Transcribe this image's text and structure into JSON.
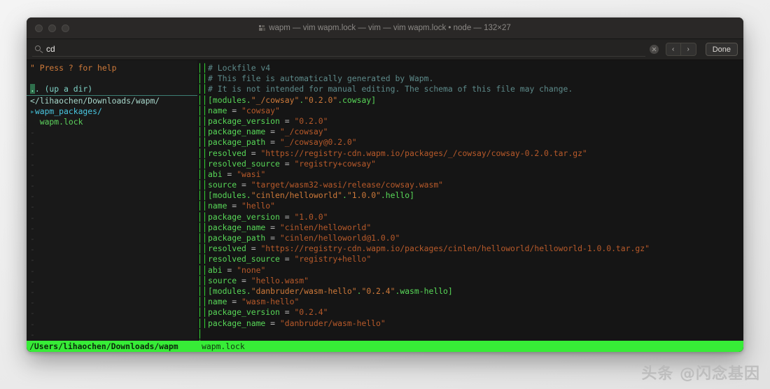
{
  "window": {
    "title": "wapm — vim wapm.lock — vim — vim wapm.lock • node — 132×27",
    "traffic_lights": [
      "close",
      "minimize",
      "zoom"
    ]
  },
  "findbar": {
    "query": "cd",
    "placeholder": "Search",
    "clear_label": "",
    "prev_label": "‹",
    "next_label": "›",
    "done_label": "Done"
  },
  "sidebar": {
    "help_line": "\" Press ? for help",
    "up_dir": ".. (up a dir)",
    "root_path": "/lihaochen/Downloads/wapm/",
    "root_prefix": "<",
    "items": [
      {
        "mark": "▸",
        "label": "wapm_packages/",
        "type": "dir"
      },
      {
        "mark": "",
        "label": "wapm.lock",
        "type": "file"
      }
    ],
    "empty_marker": "-"
  },
  "split": {
    "glyph": "│"
  },
  "editor": {
    "lines": [
      {
        "type": "comment",
        "text": "# Lockfile v4"
      },
      {
        "type": "comment",
        "text": "# This file is automatically generated by Wapm."
      },
      {
        "type": "comment",
        "text": "# It is not intended for manual editing. The schema of this file may change."
      },
      {
        "type": "table",
        "text": "[modules.\"_/cowsay\".\"0.2.0\".cowsay]"
      },
      {
        "type": "pair",
        "key": "name",
        "value": "\"cowsay\""
      },
      {
        "type": "pair",
        "key": "package_version",
        "value": "\"0.2.0\""
      },
      {
        "type": "pair",
        "key": "package_name",
        "value": "\"_/cowsay\""
      },
      {
        "type": "pair",
        "key": "package_path",
        "value": "\"_/cowsay@0.2.0\""
      },
      {
        "type": "pair",
        "key": "resolved",
        "value": "\"https://registry-cdn.wapm.io/packages/_/cowsay/cowsay-0.2.0.tar.gz\""
      },
      {
        "type": "pair",
        "key": "resolved_source",
        "value": "\"registry+cowsay\""
      },
      {
        "type": "pair",
        "key": "abi",
        "value": "\"wasi\""
      },
      {
        "type": "pair",
        "key": "source",
        "value": "\"target/wasm32-wasi/release/cowsay.wasm\""
      },
      {
        "type": "table",
        "text": "[modules.\"cinlen/helloworld\".\"1.0.0\".hello]"
      },
      {
        "type": "pair",
        "key": "name",
        "value": "\"hello\""
      },
      {
        "type": "pair",
        "key": "package_version",
        "value": "\"1.0.0\""
      },
      {
        "type": "pair",
        "key": "package_name",
        "value": "\"cinlen/helloworld\""
      },
      {
        "type": "pair",
        "key": "package_path",
        "value": "\"cinlen/helloworld@1.0.0\""
      },
      {
        "type": "pair",
        "key": "resolved",
        "value": "\"https://registry-cdn.wapm.io/packages/cinlen/helloworld/helloworld-1.0.0.tar.gz\""
      },
      {
        "type": "pair",
        "key": "resolved_source",
        "value": "\"registry+hello\""
      },
      {
        "type": "pair",
        "key": "abi",
        "value": "\"none\""
      },
      {
        "type": "pair",
        "key": "source",
        "value": "\"hello.wasm\""
      },
      {
        "type": "table",
        "text": "[modules.\"danbruder/wasm-hello\".\"0.2.4\".wasm-hello]"
      },
      {
        "type": "pair",
        "key": "name",
        "value": "\"wasm-hello\""
      },
      {
        "type": "pair",
        "key": "package_version",
        "value": "\"0.2.4\""
      },
      {
        "type": "pair",
        "key": "package_name",
        "value": "\"danbruder/wasm-hello\""
      }
    ],
    "operator": "="
  },
  "statusline": {
    "left": "/Users/lihaochen/Downloads/wapm",
    "right": "wapm.lock"
  },
  "watermark": {
    "text": "头条 @闪念基因"
  },
  "colors": {
    "accent_green": "#37ec37",
    "comment": "#5d8a8a",
    "key": "#58d858",
    "string": "#b85a2a",
    "dir": "#49c6e0",
    "file": "#5dd35d",
    "help": "#cf7a3a",
    "background": "#151515"
  }
}
